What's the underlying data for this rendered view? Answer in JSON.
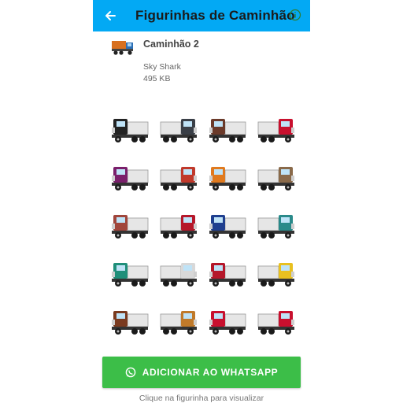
{
  "appbar": {
    "title": "Figurinhas de Caminhão",
    "back_icon": "arrow-left-icon",
    "info_icon": "info-icon"
  },
  "pack": {
    "name": "Caminhão 2",
    "author": "Sky Shark",
    "size": "495 KB"
  },
  "stickers": [
    {
      "color": "#222222"
    },
    {
      "color": "#3a3f47"
    },
    {
      "color": "#6b3a2a"
    },
    {
      "color": "#c8102e"
    },
    {
      "color": "#7a1f6b"
    },
    {
      "color": "#c0392b"
    },
    {
      "color": "#e07a1f"
    },
    {
      "color": "#8a6a4a"
    },
    {
      "color": "#a0463c"
    },
    {
      "color": "#b5172a"
    },
    {
      "color": "#1f3f8f"
    },
    {
      "color": "#2a8a8a"
    },
    {
      "color": "#1f8f7a"
    },
    {
      "color": "#d8d8d8"
    },
    {
      "color": "#b5172a"
    },
    {
      "color": "#e8c020"
    },
    {
      "color": "#7a3a1f"
    },
    {
      "color": "#c07a2a"
    },
    {
      "color": "#c8102e"
    },
    {
      "color": "#c8102e"
    }
  ],
  "actions": {
    "add_label": "ADICIONAR AO WHATSAPP",
    "hint": "Clique na figurinha para visualizar"
  },
  "colors": {
    "appbar": "#03a9f4",
    "button": "#3cbe48"
  }
}
